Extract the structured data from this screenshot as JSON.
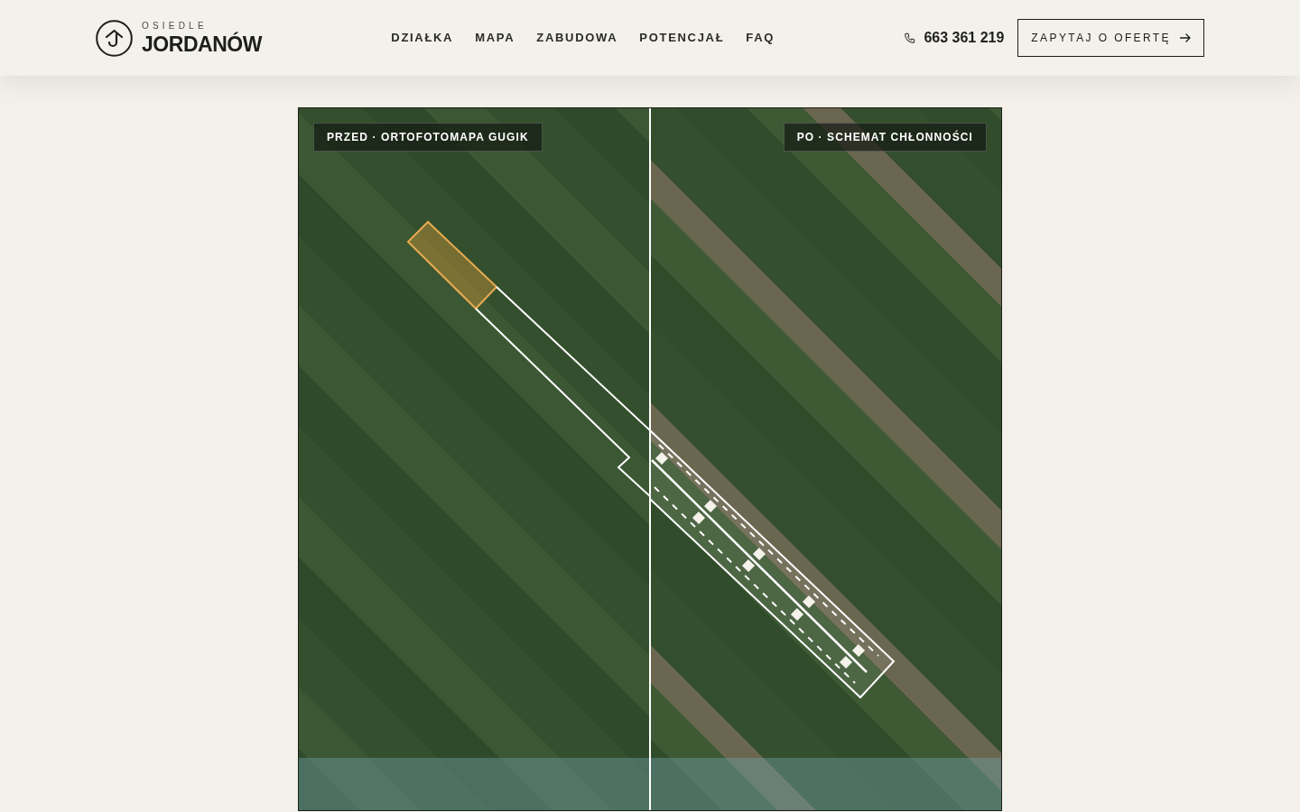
{
  "header": {
    "logo": {
      "subtitle": "OSIEDLE",
      "name": "JORDANÓW"
    },
    "nav": [
      "DZIAŁKA",
      "MAPA",
      "ZABUDOWA",
      "POTENCJAŁ",
      "FAQ"
    ],
    "phone": "663 361 219",
    "cta": "ZAPYTAJ O OFERTĘ"
  },
  "comparison": {
    "level": 0.5,
    "before_label": "PRZED · ORTOFOTOMAPA GUGIK",
    "after_label": "PO · SCHEMAT CHŁONNOŚCI"
  }
}
